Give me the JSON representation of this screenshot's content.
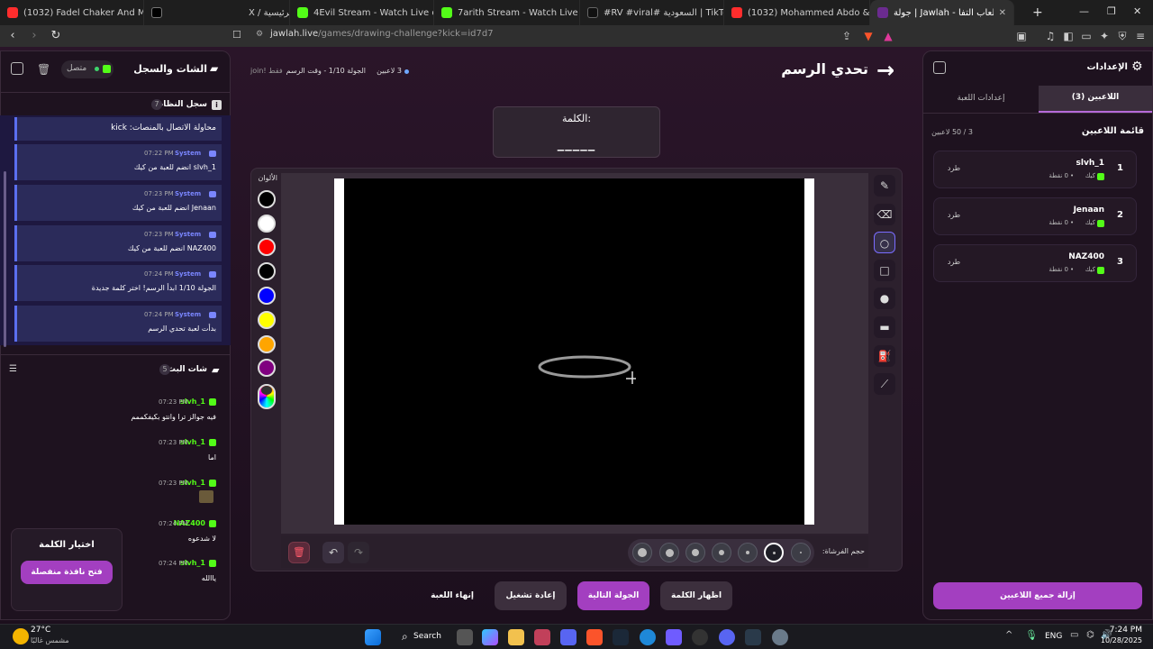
{
  "browser": {
    "tabs": [
      {
        "title": "(1032) Fadel Chaker And Mohamed",
        "color": "#ff2d2d"
      },
      {
        "title": "X / الرئيسية",
        "color": "#000000"
      },
      {
        "title": "4Evil Stream - Watch Live on Kick",
        "color": "#53fc18"
      },
      {
        "title": "7arith Stream - Watch Live on Kick",
        "color": "#53fc18"
      },
      {
        "title": "#RV #viral# السعودية | TikTok",
        "color": "#111111"
      },
      {
        "title": "(1032) Mohammed Abdo & Aye",
        "color": "#ff2d2d"
      },
      {
        "title": "جولة | Jawlah - منصة الألعاب التفا",
        "color": "#6b2b8f"
      }
    ],
    "url_domain": "jawlah.live",
    "url_path": "/games/drawing-challenge?kick=id7d7"
  },
  "left": {
    "title": "الشات والسجل",
    "status": "متصل",
    "system_log_title": "سجل النظام",
    "system_log_count": "7",
    "first_line": "محاولة الاتصال بالمنصات: kick",
    "system_messages": [
      {
        "sender": "System",
        "time": "07:22 PM",
        "text": "slvh_1 انضم للعبة من كيك"
      },
      {
        "sender": "System",
        "time": "07:23 PM",
        "text": "Jenaan انضم للعبة من كيك"
      },
      {
        "sender": "System",
        "time": "07:23 PM",
        "text": "NAZ400 انضم للعبة من كيك"
      },
      {
        "sender": "System",
        "time": "07:24 PM",
        "text": "الجولة 1/10 ابدأ الرسم! اختر كلمة جديدة"
      },
      {
        "sender": "System",
        "time": "07:24 PM",
        "text": "بدأت لعبة تحدي الرسم"
      }
    ],
    "live_chat_title": "شات البث",
    "live_chat_count": "5",
    "chat": [
      {
        "user": "slvh_1",
        "time": "07:23 PM",
        "text": "فيه جوالز ترا وانتو بكيفكممم",
        "emoji": false
      },
      {
        "user": "slvh_1",
        "time": "07:23 PM",
        "text": "اما",
        "emoji": false
      },
      {
        "user": "slvh_1",
        "time": "07:23 PM",
        "text": "",
        "emoji": true
      },
      {
        "user": "NAZ400",
        "time": "07:24 PM",
        "text": "لا شدعوه",
        "emoji": false
      },
      {
        "user": "slvh_1",
        "time": "07:24 PM",
        "text": "ياالله",
        "emoji": false
      }
    ],
    "choose_word_title": "اختيار الكلمة",
    "open_window_btn": "فتح نافذة منفصلة"
  },
  "center": {
    "title": "تحدي الرسم",
    "players_count": "3 لاعبين",
    "round_info": "الجولة 1/10 - وقت الرسم",
    "join_hint": "join! فقط",
    "word_label": "الكلمة:",
    "word_blank": "_____",
    "colors_label": "الألوان",
    "colors": [
      "#000000",
      "#ffffff",
      "#ff0000",
      "#000000",
      "#0000ff",
      "#ffff00",
      "#ffa500",
      "#800080"
    ],
    "brush_size_label": "حجم الفرشاة:",
    "buttons": {
      "show_word": "اظهار الكلمة",
      "next_round": "الجولة التالية",
      "restart": "إعادة تشغيل",
      "end_game": "إنهاء اللعبة"
    }
  },
  "right": {
    "title": "الإعدادات",
    "tab_players": "اللاعبين (3)",
    "tab_game_settings": "إعدادات اللعبة",
    "players_list_title": "قائمة اللاعبين",
    "players_capacity": "3 / 50 لاعبين",
    "players": [
      {
        "rank": "1",
        "name": "slvh_1",
        "platform": "كيك",
        "points": "0 نقطة",
        "kick_label": "طرد"
      },
      {
        "rank": "2",
        "name": "Jenaan",
        "platform": "كيك",
        "points": "0 نقطة",
        "kick_label": "طرد"
      },
      {
        "rank": "3",
        "name": "NAZ400",
        "platform": "كيك",
        "points": "0 نقطة",
        "kick_label": "طرد"
      }
    ],
    "remove_all_btn": "إزالة جميع اللاعبين"
  },
  "taskbar": {
    "weather_temp": "27°C",
    "weather_desc": "مشمس غالبًا",
    "search": "Search",
    "lang": "ENG",
    "time": "7:24 PM",
    "date": "10/28/2025"
  }
}
